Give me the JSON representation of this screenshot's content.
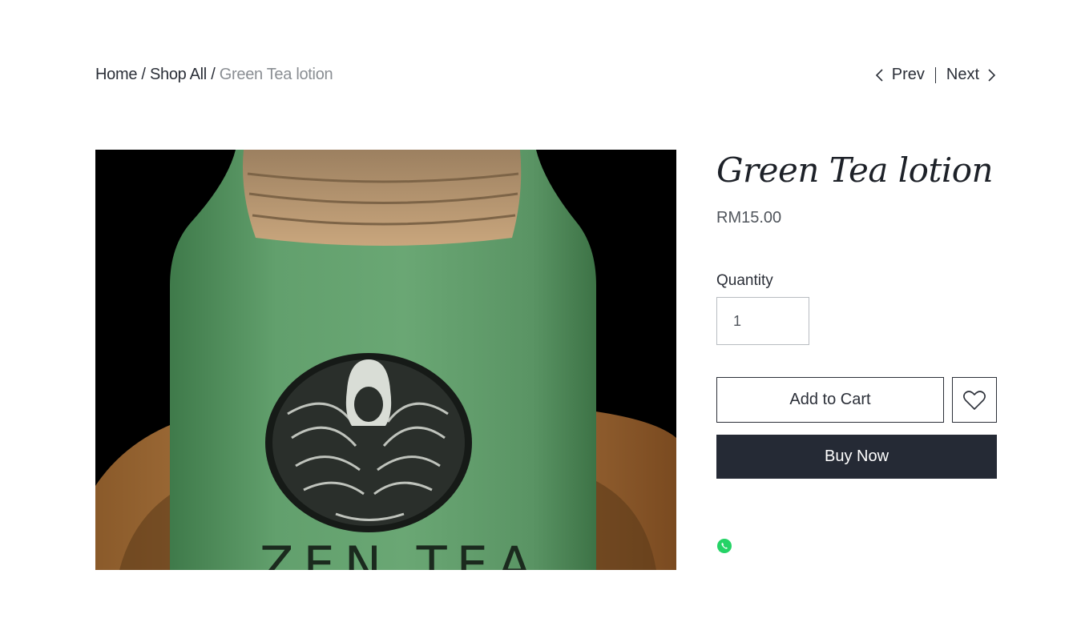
{
  "breadcrumb": {
    "home": "Home",
    "sep1": "/",
    "shop": "Shop All",
    "sep2": "/",
    "current": "Green Tea lotion"
  },
  "pager": {
    "prev": "Prev",
    "next": "Next"
  },
  "product": {
    "title": "Green Tea lotion",
    "price": "RM15.00",
    "image_text": "ZEN TEA"
  },
  "quantity": {
    "label": "Quantity",
    "value": "1"
  },
  "actions": {
    "add_to_cart": "Add to Cart",
    "buy_now": "Buy Now"
  },
  "icons": {
    "wishlist": "heart-icon",
    "share": "whatsapp-icon",
    "prev": "chevron-left-icon",
    "next": "chevron-right-icon"
  },
  "colors": {
    "primary_button": "#252a35",
    "text": "#2b2f38",
    "muted": "#8a8e93",
    "whatsapp": "#25d366"
  }
}
